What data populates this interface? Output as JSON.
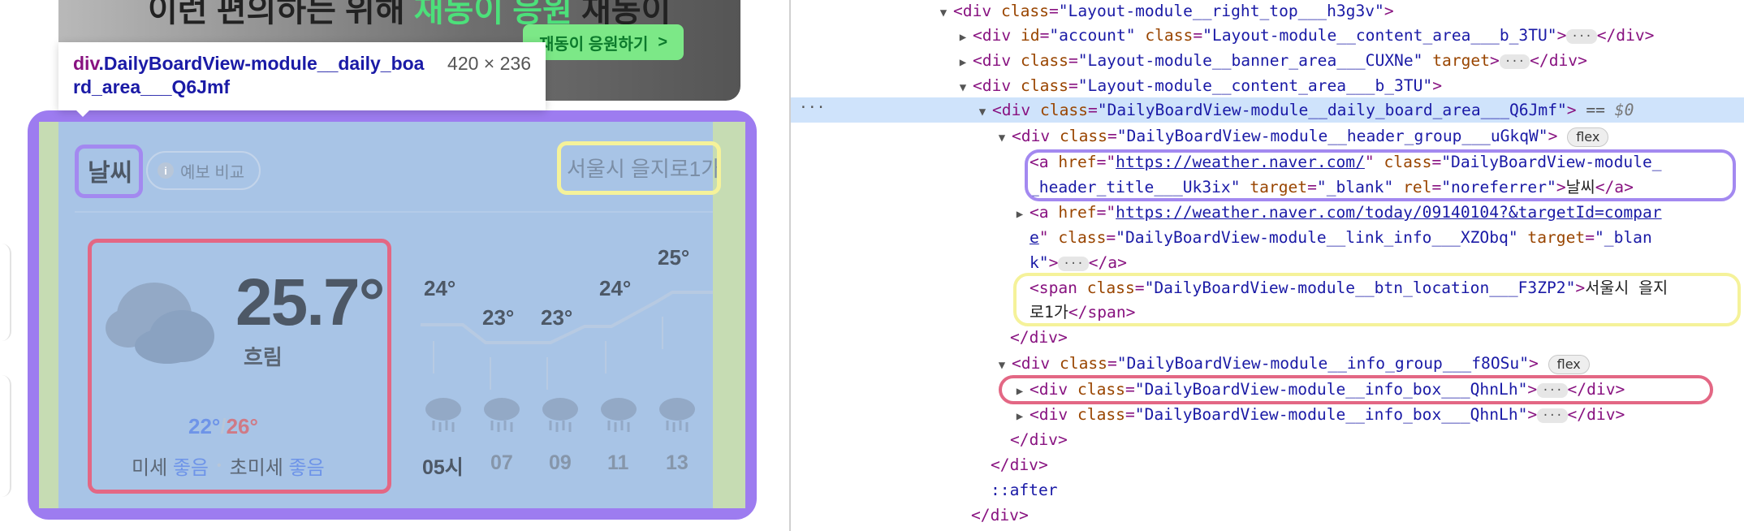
{
  "preview": {
    "banner": {
      "text_prefix": "이런 편의하는 위해 ",
      "text_highlight": "재동이 응원",
      "text_suffix": " 재동이",
      "button_label": "재동이 응원하기",
      "button_chevron": ">"
    },
    "tooltip": {
      "tag": "div",
      "class_name": ".DailyBoardView-module__daily_board_area___Q6Jmf",
      "size": "420 × 236"
    },
    "weather": {
      "title": "날씨",
      "compare_label": "예보 비교",
      "location": "서울시 을지로1가",
      "current_temp": "25.7°",
      "condition": "흐림",
      "min_temp": "22°",
      "separator": "/",
      "max_temp": "26°",
      "dust_label": "미세",
      "dust_value": "좋음",
      "ultrafine_label": "초미세",
      "ultrafine_value": "좋음",
      "forecast": [
        {
          "time": "05시",
          "temp": "24°"
        },
        {
          "time": "07",
          "temp": "23°"
        },
        {
          "time": "09",
          "temp": "23°"
        },
        {
          "time": "11",
          "temp": "24°"
        },
        {
          "time": "13",
          "temp": "25°"
        }
      ]
    }
  },
  "devtools": {
    "lines": {
      "l1": {
        "tag": "<div ",
        "attr1": "class",
        "val1": "\"Layout-module__right_top___h3g3v\"",
        "end": ">"
      },
      "l2": {
        "tag": "<div ",
        "attr1": "id",
        "val1": "\"account\"",
        "attr2": "class",
        "val2": "\"Layout-module__content_area___b_3TU\"",
        "close": "</div>"
      },
      "l3": {
        "tag": "<div ",
        "attr1": "class",
        "val1": "\"Layout-module__banner_area___CUXNe\"",
        "attr2": "target",
        "close": "</div>"
      },
      "l4": {
        "tag": "<div ",
        "attr1": "class",
        "val1": "\"Layout-module__content_area___b_3TU\"",
        "end": ">"
      },
      "l5": {
        "tag": "<div ",
        "attr1": "class",
        "val1": "\"DailyBoardView-module__daily_board_area___Q6Jmf\"",
        "end": ">",
        "eq": "==",
        "dollar": "$0"
      },
      "l6": {
        "tag": "<div ",
        "attr1": "class",
        "val1": "\"DailyBoardView-module__header_group___uGkqW\"",
        "end": ">",
        "pill": "flex"
      },
      "l7": {
        "tag": "<a ",
        "attr1": "href",
        "link1": "https://weather.naver.com/",
        "attr2": "class",
        "val2": "\"DailyBoardView-module_"
      },
      "l8": {
        "val": "_header_title___Uk3ix\"",
        "attr1": "target",
        "val1": "\"_blank\"",
        "attr2": "rel",
        "val2": "\"noreferrer\"",
        "text": "날씨",
        "close": "</a>"
      },
      "l9": {
        "tag": "<a ",
        "attr1": "href",
        "link1": "https://weather.naver.com/today/09140104?&targetId=compar"
      },
      "l10": {
        "link": "e",
        "attr1": "class",
        "val1": "\"DailyBoardView-module__link_info___XZObq\"",
        "attr2": "target",
        "val2": "\"_blan"
      },
      "l11": {
        "val": "k\"",
        "close": "</a>"
      },
      "l12": {
        "tag": "<span ",
        "attr1": "class",
        "val1": "\"DailyBoardView-module__btn_location___F3ZP2\"",
        "text": "서울시 을지"
      },
      "l13": {
        "text": "로1가",
        "close": "</span>"
      },
      "l14": {
        "close": "</div>"
      },
      "l15": {
        "tag": "<div ",
        "attr1": "class",
        "val1": "\"DailyBoardView-module__info_group___f8OSu\"",
        "end": ">",
        "pill": "flex"
      },
      "l16": {
        "tag": "<div ",
        "attr1": "class",
        "val1": "\"DailyBoardView-module__info_box___QhnLh\"",
        "close": "</div>"
      },
      "l17": {
        "tag": "<div ",
        "attr1": "class",
        "val1": "\"DailyBoardView-module__info_box___QhnLh\"",
        "close": "</div>"
      },
      "l18": {
        "close": "</div>"
      },
      "l19": {
        "close": "</div>"
      },
      "l20": {
        "pseudo": "::after"
      },
      "l21": {
        "close": "</div>"
      }
    },
    "ellipsis": "···",
    "selected_marker": "···"
  },
  "colors": {
    "inspector_outline": "#9d7cf0",
    "highlight_title": "#a389f0",
    "highlight_location": "#f5f29a",
    "highlight_info": "#e36784",
    "board_overlay": "#a8c4e6",
    "padding_overlay": "#c6dcb3"
  }
}
